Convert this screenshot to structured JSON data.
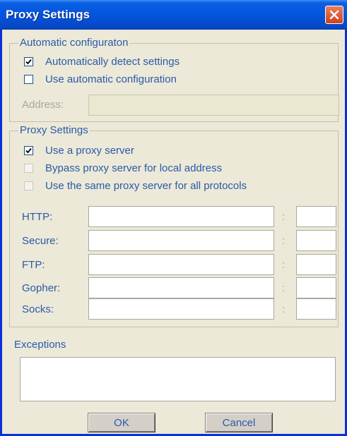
{
  "window": {
    "title": "Proxy Settings"
  },
  "auto_config": {
    "legend": "Automatic configuraton",
    "items": [
      {
        "label": "Automatically detect settings",
        "checked": true
      },
      {
        "label": "Use automatic configuration",
        "checked": false
      }
    ],
    "address": {
      "label": "Address:",
      "value": ""
    }
  },
  "proxy_settings": {
    "legend": "Proxy Settings",
    "items": [
      {
        "label": "Use a proxy server",
        "checked": true
      },
      {
        "label": "Bypass proxy server for local address",
        "checked": false,
        "disabled": true
      },
      {
        "label": "Use the same proxy server for all protocols",
        "checked": false,
        "disabled": true
      }
    ],
    "protocols": [
      {
        "label": "HTTP:",
        "host": "",
        "port": ""
      },
      {
        "label": "Secure:",
        "host": "",
        "port": ""
      },
      {
        "label": "FTP:",
        "host": "",
        "port": ""
      },
      {
        "label": "Gopher:",
        "host": "",
        "port": ""
      },
      {
        "label": "Socks:",
        "host": "",
        "port": ""
      }
    ],
    "separator": ":"
  },
  "exceptions": {
    "label": "Exceptions",
    "value": ""
  },
  "buttons": {
    "ok": "OK",
    "cancel": "Cancel"
  }
}
